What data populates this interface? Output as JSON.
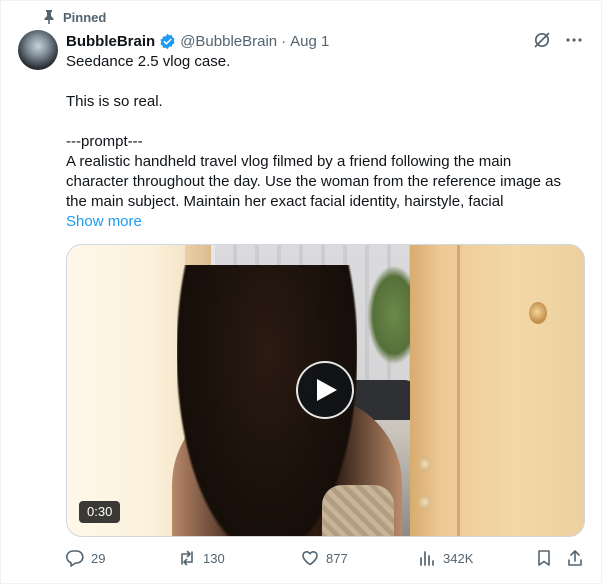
{
  "pinned_label": "Pinned",
  "author": {
    "name": "BubbleBrain",
    "handle": "@BubbleBrain",
    "separator": "·",
    "date": "Aug 1"
  },
  "post": {
    "line1": "Seedance 2.5 vlog case.",
    "line2": "This is so real.",
    "line3": "---prompt---",
    "line4": "A realistic handheld travel vlog filmed by a friend following the main character throughout the day. Use the woman from the reference image as the main subject. Maintain her exact facial identity, hairstyle, facial",
    "show_more": "Show more"
  },
  "media": {
    "duration": "0:30"
  },
  "actions": {
    "replies": "29",
    "reposts": "130",
    "likes": "877",
    "views": "342K"
  },
  "colors": {
    "accent": "#1d9bf0",
    "secondary_text": "#536471",
    "verified": "#1d9bf0"
  },
  "icons": [
    "pin-icon",
    "verified-badge-icon",
    "grok-icon",
    "more-icon",
    "play-icon",
    "reply-icon",
    "repost-icon",
    "like-icon",
    "views-icon",
    "bookmark-icon",
    "share-icon"
  ]
}
